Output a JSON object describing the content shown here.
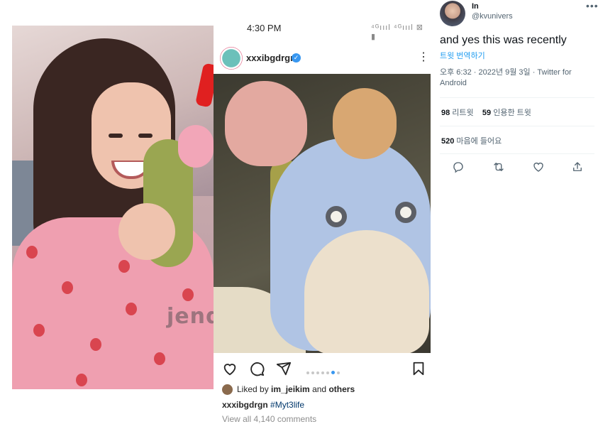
{
  "left_photo": {
    "watermark": "jend"
  },
  "instagram": {
    "status_time": "4:30 PM",
    "status_icons": "⁴ᴳıııl ⁴ᴳıııl ⊠ ▮",
    "username": "xxxibgdrgn",
    "verified_mark": "✓",
    "more_glyph": "⋮",
    "liked_by_prefix": "Liked by ",
    "liked_by_user": "im_jeikim",
    "liked_by_and": " and ",
    "liked_by_others": "others",
    "caption_user": "xxxibgdrgn",
    "caption_tag": "#Myt3life",
    "view_all": "View all 4,140 comments",
    "carousel": {
      "count": 7,
      "active": 6
    },
    "icons": [
      "heart-icon",
      "comment-icon",
      "share-icon",
      "bookmark-icon"
    ]
  },
  "tweet": {
    "name": "In",
    "handle": "@kvunivers",
    "more_glyph": "•••",
    "text": "and yes this was recently",
    "translate": "트윗 번역하기",
    "meta": "오후 6:32 · 2022년 9월 3일 · Twitter for Android",
    "retweets_count": "98",
    "retweets_label": " 리트윗",
    "quotes_count": "59",
    "quotes_label": " 인용한 트윗",
    "likes_count": "520",
    "likes_label": " 마음에 들어요",
    "icons": [
      "reply-icon",
      "retweet-icon",
      "like-icon",
      "share-icon"
    ],
    "colors": {
      "link": "#1d9bf0",
      "muted": "#536471"
    }
  }
}
